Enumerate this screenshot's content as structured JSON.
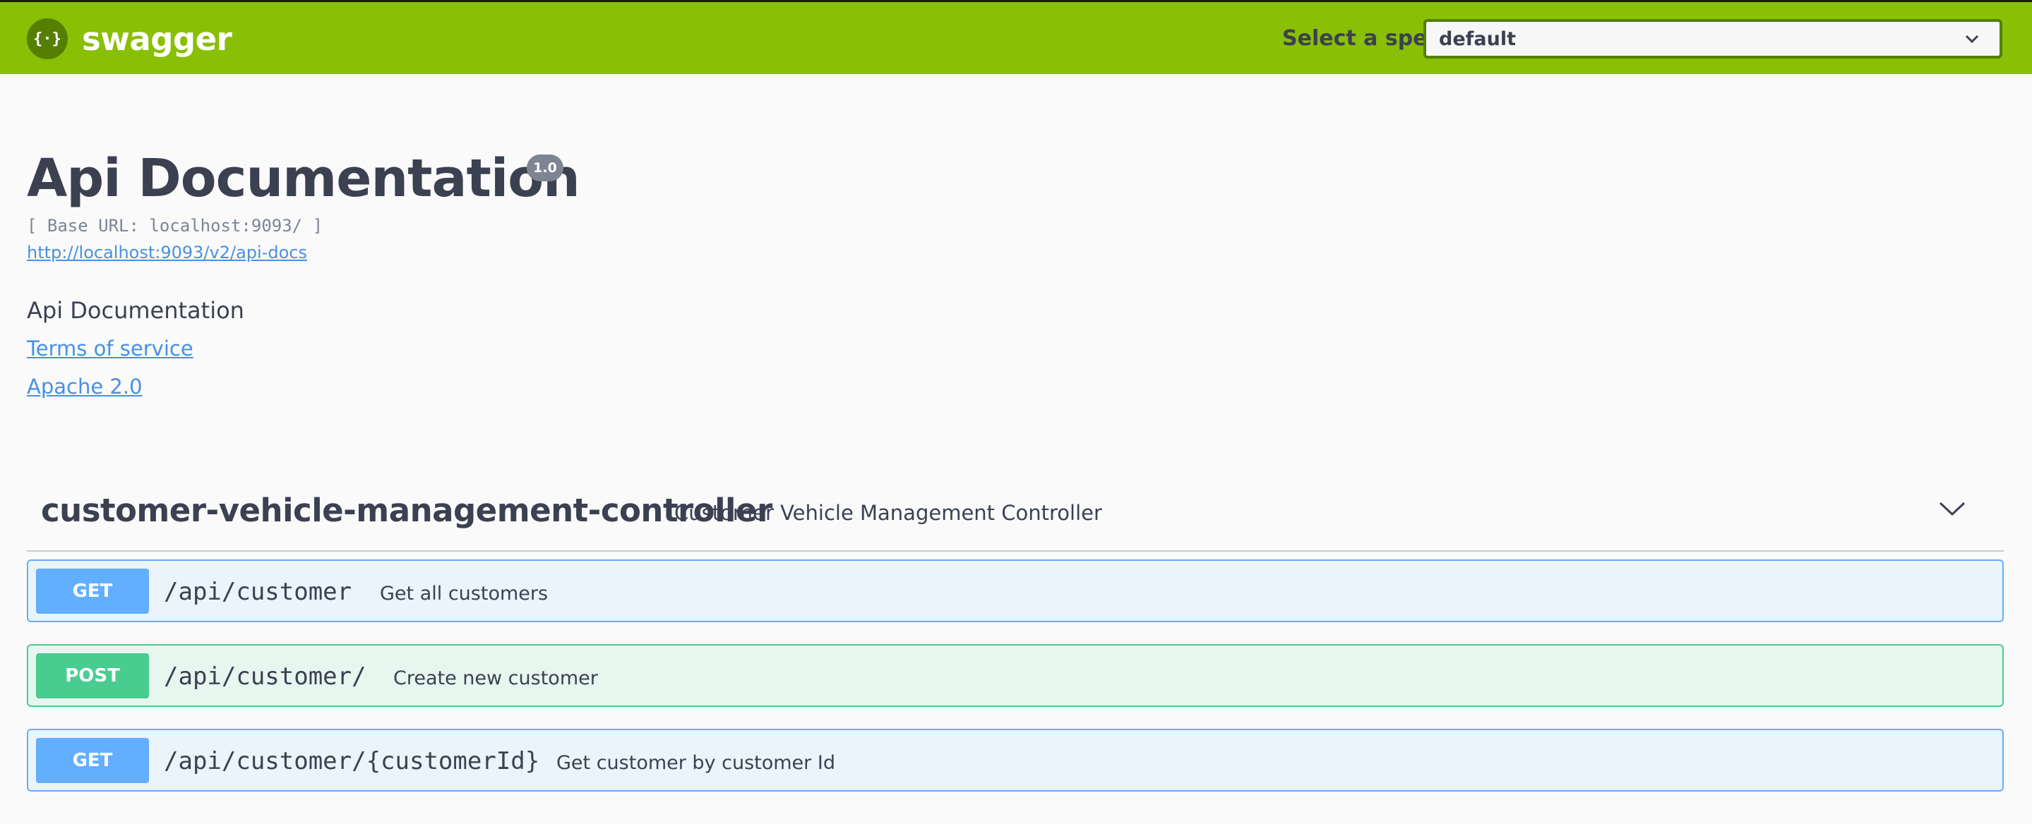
{
  "colors": {
    "topbar": "#89bf04",
    "get": "#61affe",
    "post": "#49cc90",
    "link": "#4990e2",
    "text": "#3b4151"
  },
  "header": {
    "logo_text": "swagger",
    "logo_icon": "swagger-braces-icon",
    "spec_label": "Select a spec",
    "spec_selected": "default"
  },
  "info": {
    "title": "Api Documentation",
    "version": "1.0",
    "base_url": "[ Base URL: localhost:9093/ ]",
    "api_docs_url": "http://localhost:9093/v2/api-docs",
    "description": "Api Documentation",
    "terms_of_service": "Terms of service",
    "license": "Apache 2.0"
  },
  "tag": {
    "name": "customer-vehicle-management-controller",
    "description": "Customer Vehicle Management Controller",
    "operations": [
      {
        "method": "GET",
        "path": "/api/customer",
        "summary": "Get all customers"
      },
      {
        "method": "POST",
        "path": "/api/customer/",
        "summary": "Create new customer"
      },
      {
        "method": "GET",
        "path": "/api/customer/{customerId}",
        "summary": "Get customer by customer Id"
      }
    ]
  }
}
